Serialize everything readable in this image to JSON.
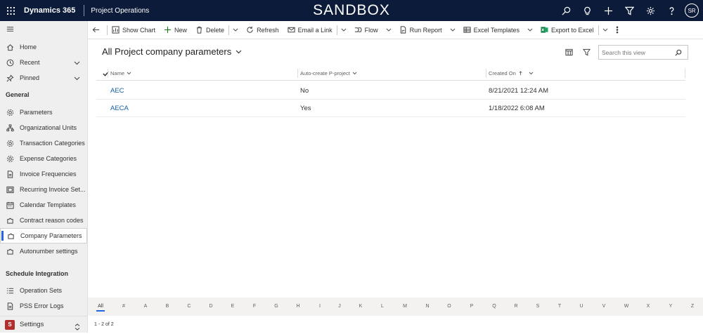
{
  "topbar": {
    "brand": "Dynamics 365",
    "app_name": "Project Operations",
    "environment_banner": "SANDBOX",
    "user_initials": "SR",
    "icons": [
      "search-icon",
      "lightbulb-icon",
      "plus-icon",
      "filter-icon",
      "gear-icon",
      "help-icon"
    ]
  },
  "sidebar": {
    "top_items": [
      {
        "label": "Home",
        "icon": "home-icon"
      },
      {
        "label": "Recent",
        "icon": "clock-icon"
      },
      {
        "label": "Pinned",
        "icon": "pin-icon"
      }
    ],
    "sections": [
      {
        "header": "General",
        "items": [
          {
            "label": "Parameters"
          },
          {
            "label": "Organizational Units"
          },
          {
            "label": "Transaction Categories"
          },
          {
            "label": "Expense Categories"
          },
          {
            "label": "Invoice Frequencies"
          },
          {
            "label": "Recurring Invoice Set..."
          },
          {
            "label": "Calendar Templates"
          },
          {
            "label": "Contract reason codes"
          },
          {
            "label": "Company Parameters"
          },
          {
            "label": "Autonumber settings"
          }
        ]
      },
      {
        "header": "Schedule Integration",
        "items": [
          {
            "label": "Operation Sets"
          },
          {
            "label": "PSS Error Logs"
          }
        ]
      }
    ],
    "active_item": "Company Parameters",
    "area": {
      "badge": "S",
      "label": "Settings"
    }
  },
  "commandbar": {
    "show_chart": "Show Chart",
    "new": "New",
    "delete": "Delete",
    "refresh": "Refresh",
    "email_link": "Email a Link",
    "flow": "Flow",
    "run_report": "Run Report",
    "excel_templates": "Excel Templates",
    "export_excel": "Export to Excel"
  },
  "view": {
    "title": "All Project company parameters",
    "search_placeholder": "Search this view"
  },
  "grid": {
    "columns": [
      "Name",
      "Auto-create P-project",
      "Created On"
    ],
    "rows": [
      {
        "name": "AEC",
        "auto_create": "No",
        "created_on": "8/21/2021 12:24 AM"
      },
      {
        "name": "AECA",
        "auto_create": "Yes",
        "created_on": "1/18/2022 6:08 AM"
      }
    ]
  },
  "jumpbar": [
    "All",
    "#",
    "A",
    "B",
    "C",
    "D",
    "E",
    "F",
    "G",
    "H",
    "I",
    "J",
    "K",
    "L",
    "M",
    "N",
    "O",
    "P",
    "Q",
    "R",
    "S",
    "T",
    "U",
    "V",
    "W",
    "X",
    "Y",
    "Z"
  ],
  "footer": {
    "record_count": "1 - 2 of 2"
  }
}
